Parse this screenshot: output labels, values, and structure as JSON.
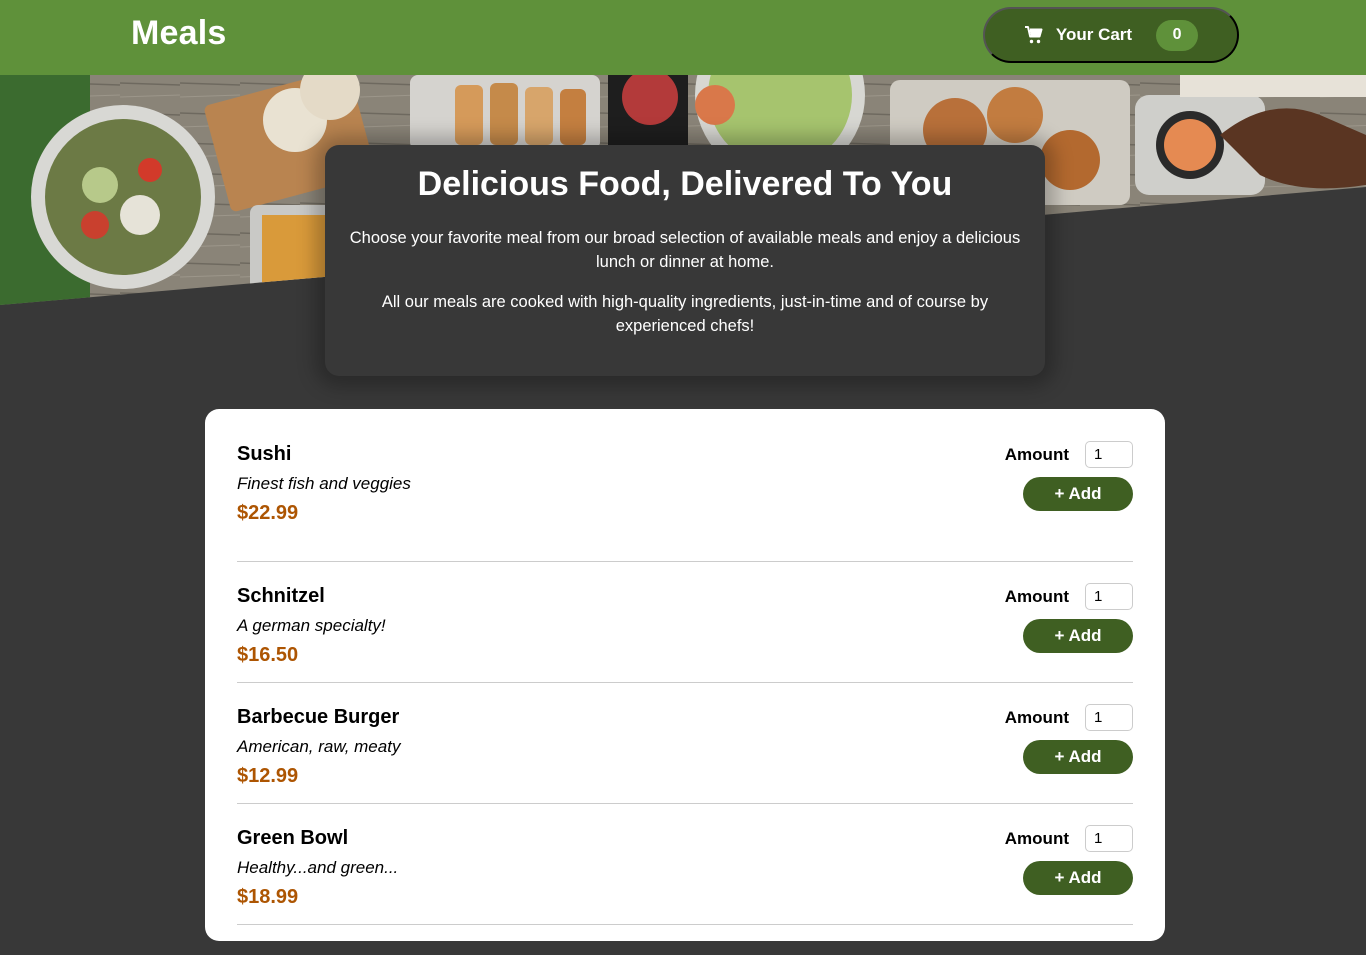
{
  "header": {
    "brand": "Meals",
    "cart_label": "Your Cart",
    "cart_count": "0",
    "cart_icon": "cart-icon"
  },
  "colors": {
    "header_bg": "#5f913a",
    "accent_dark": "#3f5f22",
    "price": "#ad5502",
    "page_bg": "#383838"
  },
  "summary": {
    "title": "Delicious Food, Delivered To You",
    "paragraph1": "Choose your favorite meal from our broad selection of available meals and enjoy a delicious lunch or dinner at home.",
    "paragraph2": "All our meals are cooked with high-quality ingredients, just-in-time and of course by experienced chefs!"
  },
  "meals": [
    {
      "name": "Sushi",
      "description": "Finest fish and veggies",
      "price": "$22.99",
      "amount_label": "Amount",
      "amount": "1",
      "add_label": "+ Add"
    },
    {
      "name": "Schnitzel",
      "description": "A german specialty!",
      "price": "$16.50",
      "amount_label": "Amount",
      "amount": "1",
      "add_label": "+ Add"
    },
    {
      "name": "Barbecue Burger",
      "description": "American, raw, meaty",
      "price": "$12.99",
      "amount_label": "Amount",
      "amount": "1",
      "add_label": "+ Add"
    },
    {
      "name": "Green Bowl",
      "description": "Healthy...and green...",
      "price": "$18.99",
      "amount_label": "Amount",
      "amount": "1",
      "add_label": "+ Add"
    }
  ]
}
